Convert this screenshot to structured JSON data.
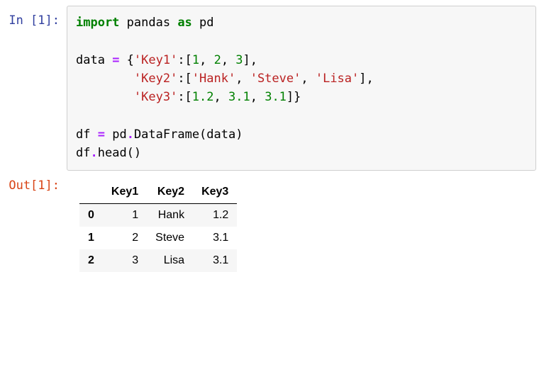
{
  "input": {
    "prompt_label": "In [1]:",
    "code_tokens": [
      {
        "t": "import",
        "c": "kw-green"
      },
      {
        "t": " pandas ",
        "c": ""
      },
      {
        "t": "as",
        "c": "kw-green"
      },
      {
        "t": " pd",
        "c": ""
      },
      {
        "t": "\n",
        "c": ""
      },
      {
        "t": "\n",
        "c": ""
      },
      {
        "t": "data ",
        "c": ""
      },
      {
        "t": "=",
        "c": "op"
      },
      {
        "t": " {",
        "c": ""
      },
      {
        "t": "'Key1'",
        "c": "str"
      },
      {
        "t": ":[",
        "c": ""
      },
      {
        "t": "1",
        "c": "num"
      },
      {
        "t": ", ",
        "c": ""
      },
      {
        "t": "2",
        "c": "num"
      },
      {
        "t": ", ",
        "c": ""
      },
      {
        "t": "3",
        "c": "num"
      },
      {
        "t": "],",
        "c": ""
      },
      {
        "t": "\n",
        "c": ""
      },
      {
        "t": "        ",
        "c": ""
      },
      {
        "t": "'Key2'",
        "c": "str"
      },
      {
        "t": ":[",
        "c": ""
      },
      {
        "t": "'Hank'",
        "c": "str"
      },
      {
        "t": ", ",
        "c": ""
      },
      {
        "t": "'Steve'",
        "c": "str"
      },
      {
        "t": ", ",
        "c": ""
      },
      {
        "t": "'Lisa'",
        "c": "str"
      },
      {
        "t": "],",
        "c": ""
      },
      {
        "t": "\n",
        "c": ""
      },
      {
        "t": "        ",
        "c": ""
      },
      {
        "t": "'Key3'",
        "c": "str"
      },
      {
        "t": ":[",
        "c": ""
      },
      {
        "t": "1.2",
        "c": "num"
      },
      {
        "t": ", ",
        "c": ""
      },
      {
        "t": "3.1",
        "c": "num"
      },
      {
        "t": ", ",
        "c": ""
      },
      {
        "t": "3.1",
        "c": "num"
      },
      {
        "t": "]}",
        "c": ""
      },
      {
        "t": "\n",
        "c": ""
      },
      {
        "t": "\n",
        "c": ""
      },
      {
        "t": "df ",
        "c": ""
      },
      {
        "t": "=",
        "c": "op"
      },
      {
        "t": " pd",
        "c": ""
      },
      {
        "t": ".",
        "c": "op"
      },
      {
        "t": "DataFrame(data)",
        "c": ""
      },
      {
        "t": "\n",
        "c": ""
      },
      {
        "t": "df",
        "c": ""
      },
      {
        "t": ".",
        "c": "op"
      },
      {
        "t": "head()",
        "c": ""
      }
    ]
  },
  "output": {
    "prompt_label": "Out[1]:",
    "table": {
      "columns": [
        "Key1",
        "Key2",
        "Key3"
      ],
      "index": [
        "0",
        "1",
        "2"
      ],
      "rows": [
        [
          "1",
          "Hank",
          "1.2"
        ],
        [
          "2",
          "Steve",
          "3.1"
        ],
        [
          "3",
          "Lisa",
          "3.1"
        ]
      ]
    }
  }
}
